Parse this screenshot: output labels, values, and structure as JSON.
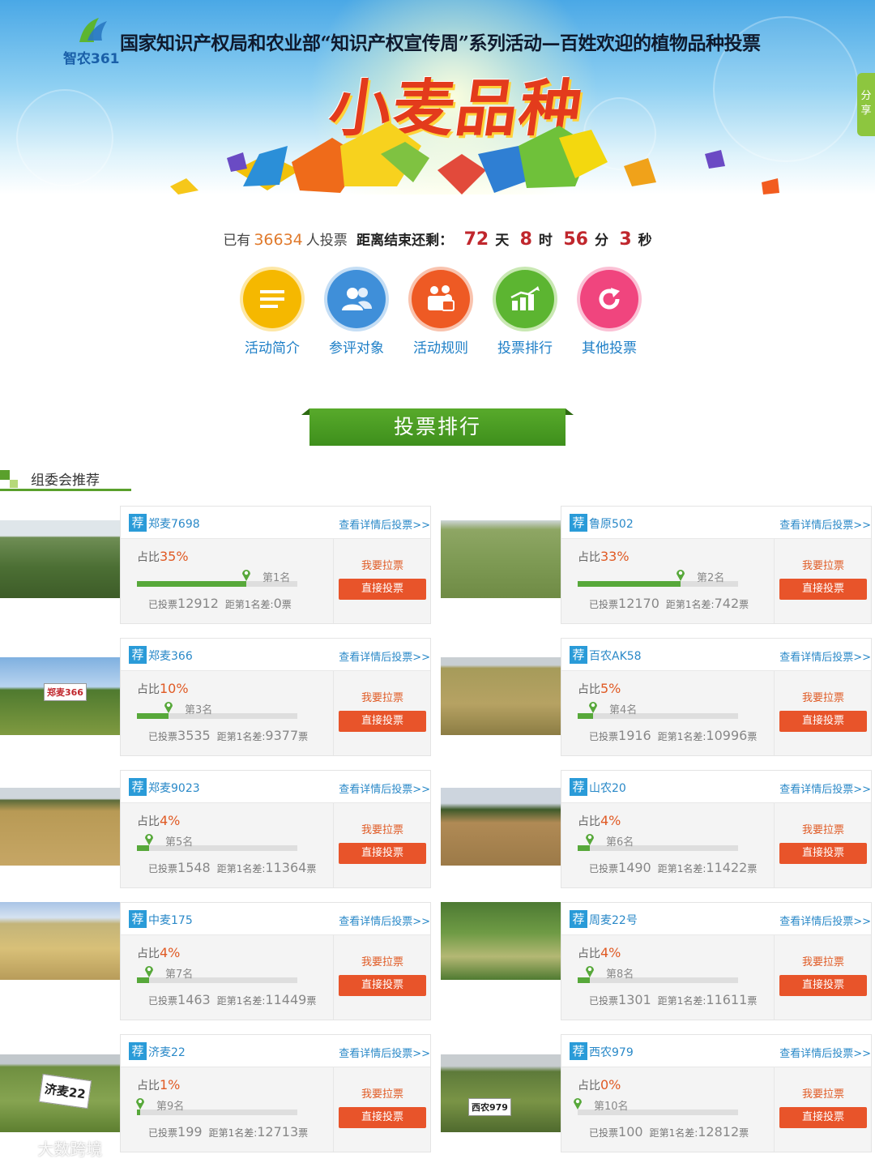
{
  "banner": {
    "logo_text": "智农361",
    "title": "国家知识产权局和农业部“知识产权宣传周”系列活动—百姓欢迎的植物品种投票",
    "headline": "小麦品种",
    "share_tab": "分享"
  },
  "stats": {
    "prefix": "已有",
    "voter_count": "36634",
    "suffix": "人投票",
    "countdown_label": "距离结束还剩：",
    "days": "72",
    "days_unit": "天",
    "hours": "8",
    "hours_unit": "时",
    "minutes": "56",
    "minutes_unit": "分",
    "seconds": "3",
    "seconds_unit": "秒"
  },
  "nav": [
    {
      "label": "活动简介",
      "icon": "list-icon",
      "color": "#f5b800"
    },
    {
      "label": "参评对象",
      "icon": "people-icon",
      "color": "#3f8fd9"
    },
    {
      "label": "活动规则",
      "icon": "rules-icon",
      "color": "#ee5a24"
    },
    {
      "label": "投票排行",
      "icon": "bar-chart-icon",
      "color": "#5cb531"
    },
    {
      "label": "其他投票",
      "icon": "refresh-icon",
      "color": "#f0457e"
    }
  ],
  "section": {
    "ribbon": "投票排行",
    "subheader": "组委会推荐"
  },
  "labels": {
    "tag": "荐",
    "detail_link": "查看详情后投票>>",
    "share_prefix": "占比",
    "votes_prefix": "已投票",
    "gap_prefix": "距第1名差:",
    "ticket_unit": "票",
    "canvass": "我要拉票",
    "vote_button": "直接投票"
  },
  "varieties": [
    {
      "name": "郑麦7698",
      "percent": "35%",
      "fraction": 0.35,
      "rank": "第1名",
      "votes": "12912",
      "gap": "0"
    },
    {
      "name": "鲁原502",
      "percent": "33%",
      "fraction": 0.33,
      "rank": "第2名",
      "votes": "12170",
      "gap": "742"
    },
    {
      "name": "郑麦366",
      "percent": "10%",
      "fraction": 0.1,
      "rank": "第3名",
      "votes": "3535",
      "gap": "9377"
    },
    {
      "name": "百农AK58",
      "percent": "5%",
      "fraction": 0.05,
      "rank": "第4名",
      "votes": "1916",
      "gap": "10996"
    },
    {
      "name": "郑麦9023",
      "percent": "4%",
      "fraction": 0.04,
      "rank": "第5名",
      "votes": "1548",
      "gap": "11364"
    },
    {
      "name": "山农20",
      "percent": "4%",
      "fraction": 0.04,
      "rank": "第6名",
      "votes": "1490",
      "gap": "11422"
    },
    {
      "name": "中麦175",
      "percent": "4%",
      "fraction": 0.04,
      "rank": "第7名",
      "votes": "1463",
      "gap": "11449"
    },
    {
      "name": "周麦22号",
      "percent": "4%",
      "fraction": 0.04,
      "rank": "第8名",
      "votes": "1301",
      "gap": "11611"
    },
    {
      "name": "济麦22",
      "percent": "1%",
      "fraction": 0.01,
      "rank": "第9名",
      "votes": "199",
      "gap": "12713"
    },
    {
      "name": "西农979",
      "percent": "0%",
      "fraction": 0.0,
      "rank": "第10名",
      "votes": "100",
      "gap": "12812"
    }
  ],
  "photo_signs": [
    "郑麦366",
    "济麦22",
    "西农979"
  ],
  "watermark": "大数跨境"
}
